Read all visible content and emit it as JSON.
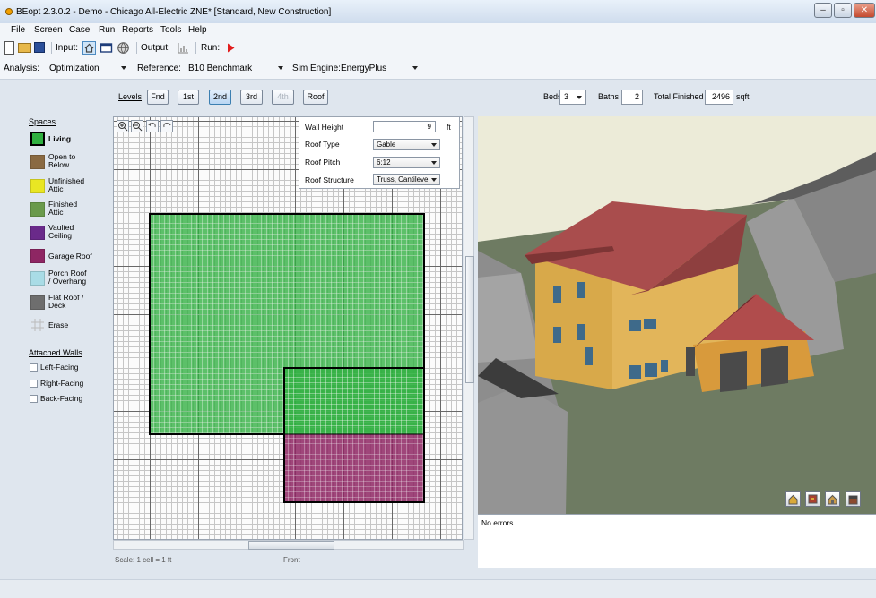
{
  "window": {
    "title": "BEopt 2.3.0.2 - Demo - Chicago All-Electric ZNE* [Standard, New Construction]"
  },
  "menu": [
    "File",
    "Screen",
    "Case",
    "Run",
    "Reports",
    "Tools",
    "Help"
  ],
  "toolbar": {
    "input_label": "Input:",
    "output_label": "Output:",
    "run_label": "Run:"
  },
  "analysis": {
    "analysis_label": "Analysis:",
    "analysis_value": "Optimization",
    "reference_label": "Reference:",
    "reference_value": "B10 Benchmark",
    "engine_label": "Sim Engine:",
    "engine_value": "EnergyPlus"
  },
  "levels": {
    "label": "Levels",
    "buttons": [
      "Fnd",
      "1st",
      "2nd",
      "3rd",
      "4th",
      "Roof"
    ],
    "selected": "2nd",
    "disabled": "4th"
  },
  "summary": {
    "beds_label": "Beds",
    "beds_value": "3",
    "baths_label": "Baths",
    "baths_value": "2",
    "total_label": "Total Finished",
    "total_value": "2496",
    "unit": "sqft"
  },
  "spaces": {
    "header": "Spaces",
    "items": [
      {
        "label": "Living",
        "color": "#30b040"
      },
      {
        "label": "Open to Below",
        "color": "#8a6a42"
      },
      {
        "label": "Unfinished Attic",
        "color": "#e9e623"
      },
      {
        "label": "Finished Attic",
        "color": "#6a9a4b"
      },
      {
        "label": "Vaulted Ceiling",
        "color": "#6a2a8a"
      },
      {
        "label": "Garage Roof",
        "color": "#8e2663"
      },
      {
        "label": "Porch Roof / Overhang",
        "color": "#a9dce6"
      },
      {
        "label": "Flat Roof / Deck",
        "color": "#6e6e6e"
      },
      {
        "label": "Erase",
        "color": ""
      }
    ]
  },
  "attached_walls": {
    "header": "Attached Walls",
    "items": [
      "Left-Facing",
      "Right-Facing",
      "Back-Facing"
    ]
  },
  "properties": {
    "wall_height_label": "Wall Height",
    "wall_height_value": "9",
    "wall_height_unit": "ft",
    "roof_type_label": "Roof Type",
    "roof_type_value": "Gable",
    "roof_pitch_label": "Roof Pitch",
    "roof_pitch_value": "6:12",
    "roof_structure_label": "Roof Structure",
    "roof_structure_value": "Truss, Cantileve"
  },
  "plan": {
    "scale_label": "Scale: 1 cell = 1 ft",
    "front_label": "Front"
  },
  "messages": {
    "text": "No errors."
  }
}
